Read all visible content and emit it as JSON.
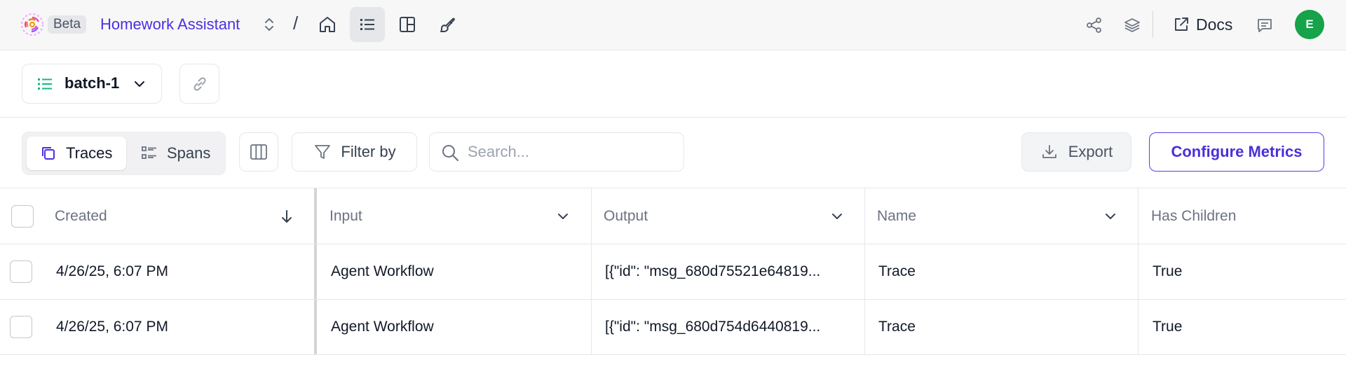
{
  "topbar": {
    "beta_label": "Beta",
    "project_name": "Homework Assistant",
    "breadcrumb_separator": "/",
    "docs_label": "Docs",
    "avatar_initial": "E",
    "avatar_color": "#16a34a",
    "accent_color": "#4f2fe0",
    "nav_icons": [
      "home-icon",
      "list-icon",
      "layout-icon",
      "brush-icon"
    ],
    "right_icons": [
      "share-icon",
      "layers-icon",
      "external-link-icon",
      "comment-icon"
    ]
  },
  "dataset": {
    "name": "batch-1"
  },
  "toolbar": {
    "tabs": [
      {
        "label": "Traces",
        "active": true
      },
      {
        "label": "Spans",
        "active": false
      }
    ],
    "filter_label": "Filter by",
    "search_placeholder": "Search...",
    "export_label": "Export",
    "configure_label": "Configure Metrics"
  },
  "table": {
    "columns": [
      "Created",
      "Input",
      "Output",
      "Name",
      "Has Children"
    ],
    "rows": [
      {
        "created": "4/26/25, 6:07 PM",
        "input": "Agent Workflow",
        "output": "[{\"id\": \"msg_680d75521e64819...",
        "name": "Trace",
        "has_children": "True"
      },
      {
        "created": "4/26/25, 6:07 PM",
        "input": "Agent Workflow",
        "output": "[{\"id\": \"msg_680d754d6440819...",
        "name": "Trace",
        "has_children": "True"
      }
    ]
  }
}
